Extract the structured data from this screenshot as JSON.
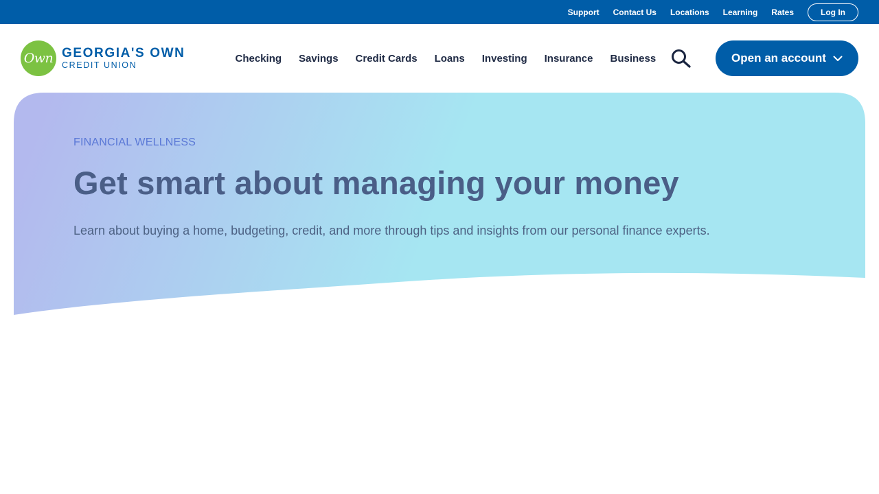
{
  "utility_nav": {
    "links": [
      "Support",
      "Contact Us",
      "Locations",
      "Learning",
      "Rates"
    ],
    "login_label": "Log In"
  },
  "logo": {
    "mark_text": "Own",
    "name": "GEORGIA'S OWN",
    "subtitle": "CREDIT UNION"
  },
  "main_nav": {
    "items": [
      "Checking",
      "Savings",
      "Credit Cards",
      "Loans",
      "Investing",
      "Insurance",
      "Business"
    ],
    "search_icon": "search-icon",
    "cta_label": "Open an account",
    "cta_icon": "chevron-down-icon"
  },
  "hero": {
    "eyebrow": "FINANCIAL WELLNESS",
    "title": "Get smart about managing your money",
    "description": "Learn about buying a home, budgeting, credit, and more through tips and insights from our personal finance experts."
  },
  "colors": {
    "brand_blue": "#005da8",
    "brand_green": "#7cc242",
    "hero_gradient_start": "#b3b9ee",
    "hero_gradient_end": "#a6e6f2"
  }
}
